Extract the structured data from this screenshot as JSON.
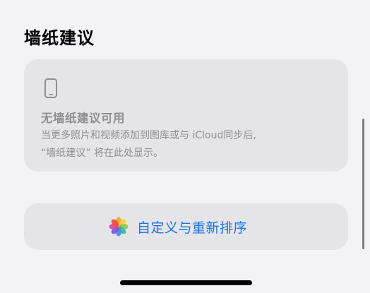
{
  "section": {
    "title": "墙纸建议"
  },
  "empty_state": {
    "icon": "iphone-icon",
    "heading": "无墙纸建议可用",
    "description_lines": [
      "当更多照片和视频添加到图库或与 iCloud同步后,",
      "“墙纸建议” 将在此处显示。"
    ]
  },
  "action": {
    "icon": "photos-app-icon",
    "label": "自定义与重新排序",
    "color": "#1a73e8"
  },
  "colors": {
    "background": "#f2f2f7",
    "card": "#e4e4e9",
    "secondary_text": "#8e8e93"
  }
}
